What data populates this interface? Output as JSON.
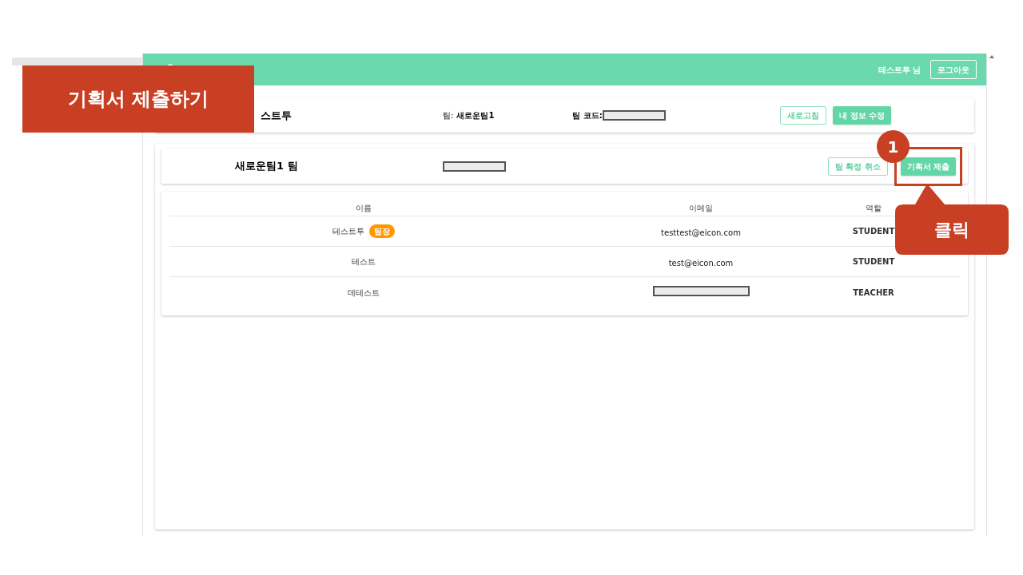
{
  "header": {
    "user": "테스트투 님",
    "logout": "로그아웃"
  },
  "profile": {
    "name": "스트투",
    "team_label": "팀:",
    "team_value": "새로운팀1",
    "code_label": "팀 코드:",
    "code_redacted": true,
    "buttons": [
      {
        "label": "새로고침",
        "kind": "outline"
      },
      {
        "label": "내 정보 수정",
        "kind": "filled"
      }
    ]
  },
  "team": {
    "title": "새로운팀1 팀",
    "code_redacted": true,
    "buttons": [
      {
        "label": "팀 확정 취소",
        "kind": "outline",
        "highlighted": false
      },
      {
        "label": "기획서 제출",
        "kind": "filled",
        "highlighted": true
      }
    ]
  },
  "table": {
    "columns": [
      "이름",
      "이메일",
      "역할"
    ],
    "rows": [
      {
        "name": "테스트투",
        "badge": "팀장",
        "email": "testtest@eicon.com",
        "redacted": false,
        "role": "STUDENT"
      },
      {
        "name": "테스트",
        "email": "test@eicon.com",
        "redacted": false,
        "role": "STUDENT"
      },
      {
        "name": "데테스트",
        "redacted": true,
        "role": "TEACHER"
      }
    ]
  },
  "annotation": {
    "banner": "기획서 제출하기",
    "step": "1",
    "callout": "클릭"
  }
}
